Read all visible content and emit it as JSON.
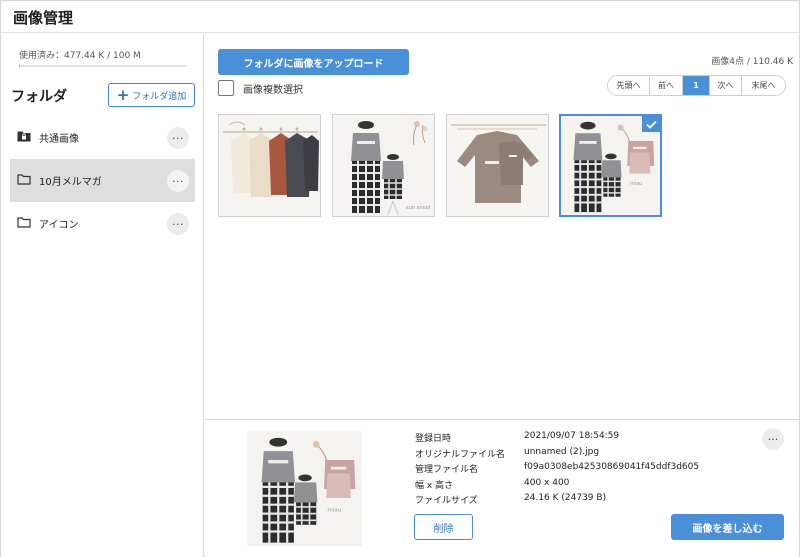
{
  "header": {
    "title": "画像管理"
  },
  "sidebar": {
    "usage_text": "使用済み：477.44 K / 100 M",
    "usage_fraction": 0.0048,
    "folder_heading": "フォルダ",
    "add_folder_label": "フォルダ追加",
    "folders": [
      {
        "label": "共通画像",
        "icon": "shared-folder-icon",
        "active": false
      },
      {
        "label": "10月メルマガ",
        "icon": "folder-icon",
        "active": true
      },
      {
        "label": "アイコン",
        "icon": "folder-icon",
        "active": false
      }
    ],
    "more_glyph": "···"
  },
  "main": {
    "upload_label": "フォルダに画像をアップロード",
    "stats_text": "画像4点 / 110.46 K",
    "multi_select_label": "画像複数選択",
    "pager": [
      "先頭へ",
      "前へ",
      "1",
      "次へ",
      "末尾へ"
    ],
    "current_page": "1",
    "thumbnails": [
      {
        "alt": "knit-sweaters-on-hangers",
        "selected": false
      },
      {
        "alt": "kids-outfit-gray-top-check-skirt",
        "selected": false
      },
      {
        "alt": "brown-sweatshirts",
        "selected": false
      },
      {
        "alt": "kids-outfit-with-pink-sweatshirt",
        "selected": true
      }
    ]
  },
  "detail": {
    "fields": [
      {
        "key": "登録日時",
        "value": "2021/09/07 18:54:59"
      },
      {
        "key": "オリジナルファイル名",
        "value": "unnamed (2).jpg"
      },
      {
        "key": "管理ファイル名",
        "value": "f09a0308eb42530869041f45ddf3d605"
      },
      {
        "key": "幅 x 高さ",
        "value": "400 x 400"
      },
      {
        "key": "ファイルサイズ",
        "value": "24.16 K (24739 B)"
      }
    ],
    "delete_label": "削除",
    "insert_label": "画像を差し込む",
    "more_glyph": "···"
  },
  "colors": {
    "accent": "#4a90d9",
    "active_folder": "#dedede"
  }
}
